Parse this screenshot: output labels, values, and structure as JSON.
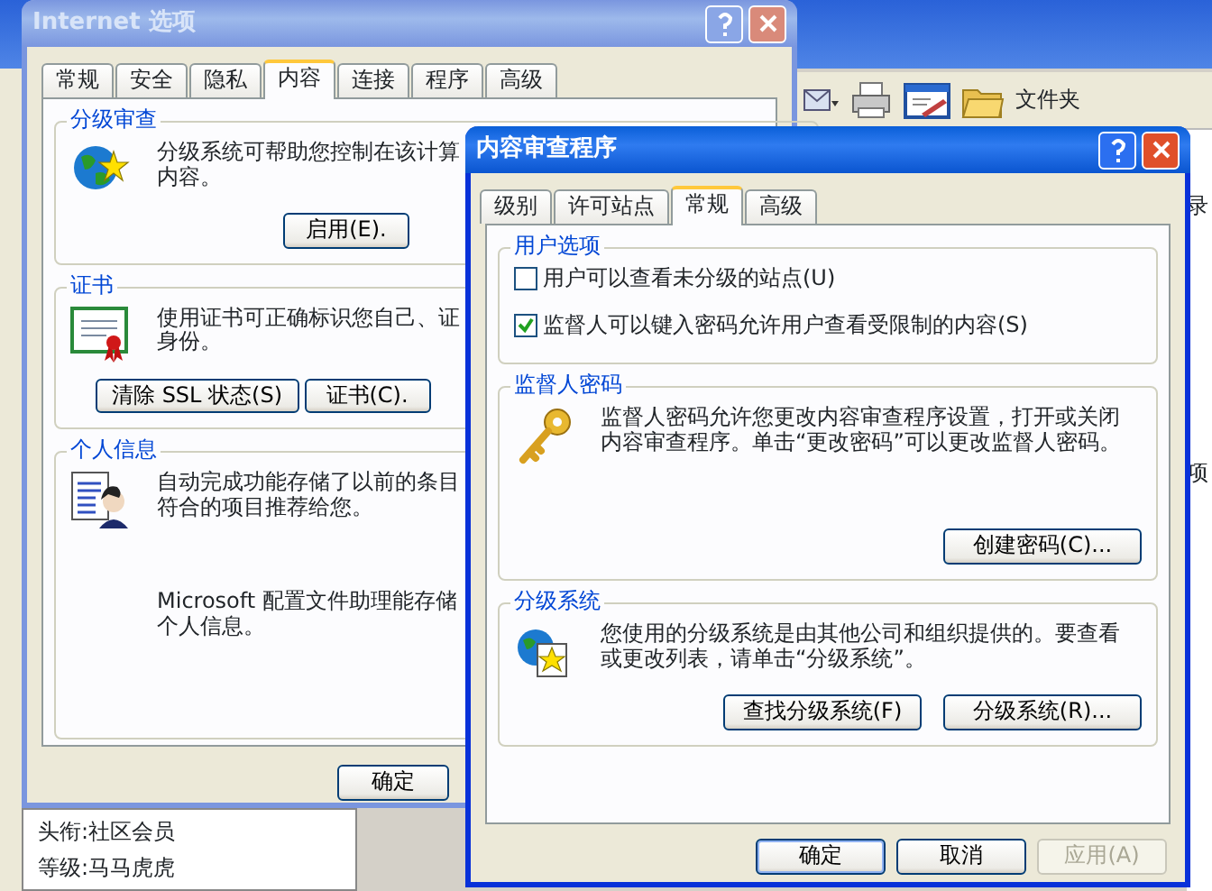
{
  "browser": {
    "toolbar_label": "文件夹",
    "side_texts": [
      "录",
      "项"
    ],
    "profile": [
      "头衔:社区会员",
      "等级:马马虎虎"
    ]
  },
  "internet_options": {
    "title": "Internet 选项",
    "active": false,
    "tabs": [
      {
        "label": "常规",
        "selected": false
      },
      {
        "label": "安全",
        "selected": false
      },
      {
        "label": "隐私",
        "selected": false
      },
      {
        "label": "内容",
        "selected": true
      },
      {
        "label": "连接",
        "selected": false
      },
      {
        "label": "程序",
        "selected": false
      },
      {
        "label": "高级",
        "selected": false
      }
    ],
    "groups": [
      {
        "label": "分级审查",
        "paragraphs": [
          [
            "分级系统可帮助您控制在该计算",
            "内容。"
          ]
        ],
        "buttons": [
          "启用(E)."
        ]
      },
      {
        "label": "证书",
        "paragraphs": [
          [
            "使用证书可正确标识您自己、证",
            "身份。"
          ]
        ],
        "buttons": [
          "清除 SSL 状态(S)",
          "证书(C)."
        ]
      },
      {
        "label": "个人信息",
        "paragraphs": [
          [
            "自动完成功能存储了以前的条目",
            "符合的项目推荐给您。"
          ],
          [
            "Microsoft 配置文件助理能存储",
            "个人信息。"
          ]
        ]
      }
    ],
    "buttons": [
      "确定"
    ]
  },
  "content_advisor": {
    "title": "内容审查程序",
    "active": true,
    "tabs": [
      {
        "label": "级别",
        "selected": false
      },
      {
        "label": "许可站点",
        "selected": false
      },
      {
        "label": "常规",
        "selected": true
      },
      {
        "label": "高级",
        "selected": false
      }
    ],
    "groups": [
      {
        "kind": "options",
        "label": "用户选项",
        "options": [
          {
            "label": "用户可以查看未分级的站点(U)",
            "checked": false
          },
          {
            "label": "监督人可以键入密码允许用户查看受限制的内容(S)",
            "checked": true
          }
        ]
      },
      {
        "kind": "text",
        "label": "监督人密码",
        "text": "监督人密码允许您更改内容审查程序设置，打开或关闭内容审查程序。单击“更改密码”可以更改监督人密码。",
        "buttons": [
          "创建密码(C)..."
        ]
      },
      {
        "kind": "text",
        "label": "分级系统",
        "text": "您使用的分级系统是由其他公司和组织提供的。要查看或更改列表，请单击“分级系统”。",
        "buttons": [
          "查找分级系统(F)",
          "分级系统(R)..."
        ]
      }
    ],
    "buttons": [
      {
        "label": "确定",
        "disabled": false
      },
      {
        "label": "取消",
        "disabled": false
      },
      {
        "label": "应用(A)",
        "disabled": true
      }
    ]
  }
}
